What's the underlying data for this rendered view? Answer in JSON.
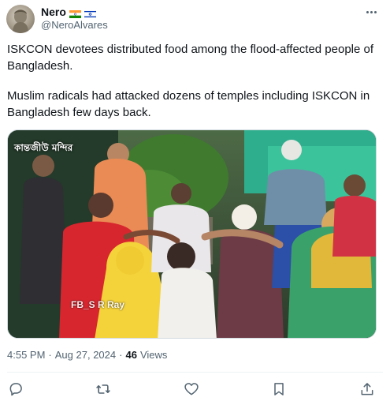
{
  "author": {
    "display_name": "Nero",
    "handle": "@NeroAlvares",
    "flags": [
      "india-flag",
      "israel-flag"
    ]
  },
  "tweet": {
    "paragraphs": [
      "ISKCON devotees distributed food among the flood-affected people of Bangladesh.",
      "Muslim radicals had attacked dozens of temples including ISKCON in Bangladesh few days back."
    ]
  },
  "media": {
    "overlay_label": "কান্তজীউ মন্দির",
    "watermark": "FB_S R Ray"
  },
  "meta": {
    "time": "4:55 PM",
    "separator": "·",
    "date": "Aug 27, 2024",
    "views_count": "46",
    "views_label": "Views"
  },
  "actions": [
    "reply-icon",
    "retweet-icon",
    "like-icon",
    "bookmark-icon",
    "share-icon"
  ],
  "colors": {
    "text": "#0f1419",
    "secondary": "#536471",
    "border": "#cfd9de"
  }
}
